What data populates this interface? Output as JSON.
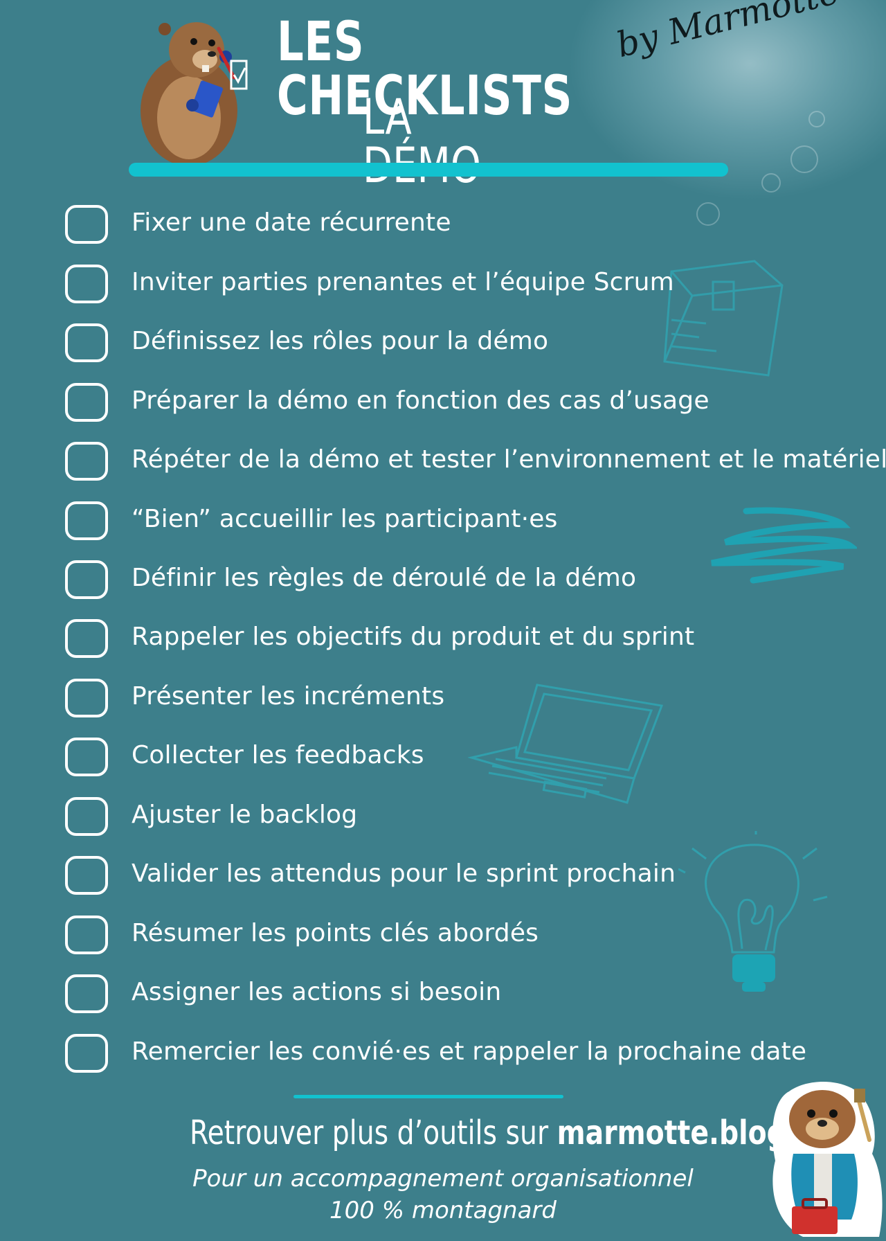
{
  "header": {
    "title": "LES CHECKLISTS",
    "subtitle": "LA DÉMO",
    "byline": "by Marmotte"
  },
  "checklist": {
    "items": [
      {
        "label": "Fixer une date récurrente",
        "checked": false
      },
      {
        "label": "Inviter parties prenantes et l’équipe Scrum",
        "checked": false
      },
      {
        "label": "Définissez les rôles pour la démo",
        "checked": false
      },
      {
        "label": "Préparer la démo en fonction des cas d’usage",
        "checked": false
      },
      {
        "label": "Répéter de la démo et tester l’environnement et le matériel",
        "checked": false
      },
      {
        "label": "“Bien” accueillir les participant·es",
        "checked": false
      },
      {
        "label": "Définir les règles de déroulé de la démo",
        "checked": false
      },
      {
        "label": "Rappeler les objectifs du produit et du sprint",
        "checked": false
      },
      {
        "label": "Présenter les incréments",
        "checked": false
      },
      {
        "label": "Collecter les feedbacks",
        "checked": false
      },
      {
        "label": "Ajuster le backlog",
        "checked": false
      },
      {
        "label": "Valider les attendus pour le sprint prochain",
        "checked": false
      },
      {
        "label": "Résumer les points clés abordés",
        "checked": false
      },
      {
        "label": "Assigner les actions si besoin",
        "checked": false
      },
      {
        "label": "Remercier les convié·es et rappeler la prochaine date",
        "checked": false
      }
    ]
  },
  "footer": {
    "cta_prefix": "Retrouver plus d’outils sur ",
    "cta_link": "marmotte.blog",
    "tagline_line1": "Pour un accompagnement organisationnel",
    "tagline_line2": "100 % montagnard"
  },
  "colors": {
    "background": "#3d7f8b",
    "accent": "#12c2cf",
    "text": "#ffffff"
  },
  "icons": [
    "marmot-with-checklist",
    "box-sketch",
    "scribble-sketch",
    "laptop-sketch",
    "lightbulb-sketch",
    "marmot-with-toolbox"
  ]
}
